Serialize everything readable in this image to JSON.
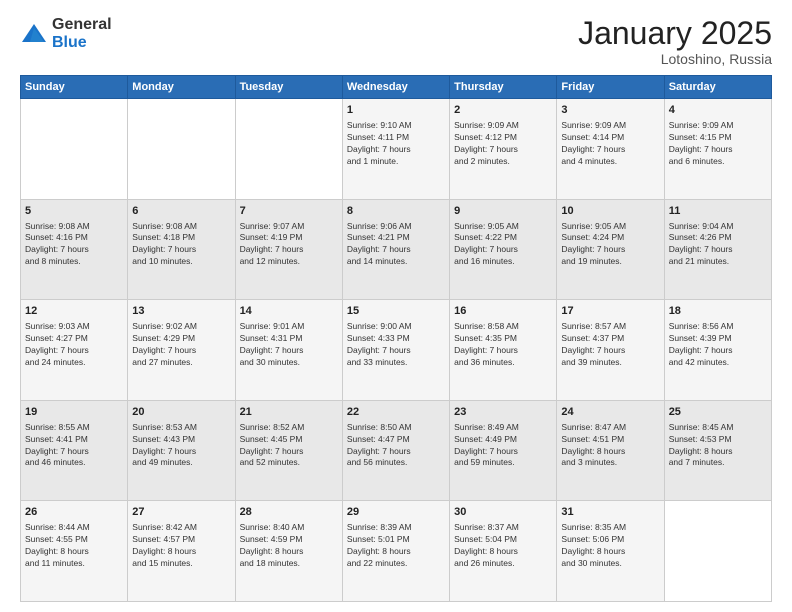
{
  "logo": {
    "general": "General",
    "blue": "Blue"
  },
  "header": {
    "month": "January 2025",
    "location": "Lotoshino, Russia"
  },
  "weekdays": [
    "Sunday",
    "Monday",
    "Tuesday",
    "Wednesday",
    "Thursday",
    "Friday",
    "Saturday"
  ],
  "weeks": [
    [
      {
        "day": "",
        "info": ""
      },
      {
        "day": "",
        "info": ""
      },
      {
        "day": "",
        "info": ""
      },
      {
        "day": "1",
        "info": "Sunrise: 9:10 AM\nSunset: 4:11 PM\nDaylight: 7 hours\nand 1 minute."
      },
      {
        "day": "2",
        "info": "Sunrise: 9:09 AM\nSunset: 4:12 PM\nDaylight: 7 hours\nand 2 minutes."
      },
      {
        "day": "3",
        "info": "Sunrise: 9:09 AM\nSunset: 4:14 PM\nDaylight: 7 hours\nand 4 minutes."
      },
      {
        "day": "4",
        "info": "Sunrise: 9:09 AM\nSunset: 4:15 PM\nDaylight: 7 hours\nand 6 minutes."
      }
    ],
    [
      {
        "day": "5",
        "info": "Sunrise: 9:08 AM\nSunset: 4:16 PM\nDaylight: 7 hours\nand 8 minutes."
      },
      {
        "day": "6",
        "info": "Sunrise: 9:08 AM\nSunset: 4:18 PM\nDaylight: 7 hours\nand 10 minutes."
      },
      {
        "day": "7",
        "info": "Sunrise: 9:07 AM\nSunset: 4:19 PM\nDaylight: 7 hours\nand 12 minutes."
      },
      {
        "day": "8",
        "info": "Sunrise: 9:06 AM\nSunset: 4:21 PM\nDaylight: 7 hours\nand 14 minutes."
      },
      {
        "day": "9",
        "info": "Sunrise: 9:05 AM\nSunset: 4:22 PM\nDaylight: 7 hours\nand 16 minutes."
      },
      {
        "day": "10",
        "info": "Sunrise: 9:05 AM\nSunset: 4:24 PM\nDaylight: 7 hours\nand 19 minutes."
      },
      {
        "day": "11",
        "info": "Sunrise: 9:04 AM\nSunset: 4:26 PM\nDaylight: 7 hours\nand 21 minutes."
      }
    ],
    [
      {
        "day": "12",
        "info": "Sunrise: 9:03 AM\nSunset: 4:27 PM\nDaylight: 7 hours\nand 24 minutes."
      },
      {
        "day": "13",
        "info": "Sunrise: 9:02 AM\nSunset: 4:29 PM\nDaylight: 7 hours\nand 27 minutes."
      },
      {
        "day": "14",
        "info": "Sunrise: 9:01 AM\nSunset: 4:31 PM\nDaylight: 7 hours\nand 30 minutes."
      },
      {
        "day": "15",
        "info": "Sunrise: 9:00 AM\nSunset: 4:33 PM\nDaylight: 7 hours\nand 33 minutes."
      },
      {
        "day": "16",
        "info": "Sunrise: 8:58 AM\nSunset: 4:35 PM\nDaylight: 7 hours\nand 36 minutes."
      },
      {
        "day": "17",
        "info": "Sunrise: 8:57 AM\nSunset: 4:37 PM\nDaylight: 7 hours\nand 39 minutes."
      },
      {
        "day": "18",
        "info": "Sunrise: 8:56 AM\nSunset: 4:39 PM\nDaylight: 7 hours\nand 42 minutes."
      }
    ],
    [
      {
        "day": "19",
        "info": "Sunrise: 8:55 AM\nSunset: 4:41 PM\nDaylight: 7 hours\nand 46 minutes."
      },
      {
        "day": "20",
        "info": "Sunrise: 8:53 AM\nSunset: 4:43 PM\nDaylight: 7 hours\nand 49 minutes."
      },
      {
        "day": "21",
        "info": "Sunrise: 8:52 AM\nSunset: 4:45 PM\nDaylight: 7 hours\nand 52 minutes."
      },
      {
        "day": "22",
        "info": "Sunrise: 8:50 AM\nSunset: 4:47 PM\nDaylight: 7 hours\nand 56 minutes."
      },
      {
        "day": "23",
        "info": "Sunrise: 8:49 AM\nSunset: 4:49 PM\nDaylight: 7 hours\nand 59 minutes."
      },
      {
        "day": "24",
        "info": "Sunrise: 8:47 AM\nSunset: 4:51 PM\nDaylight: 8 hours\nand 3 minutes."
      },
      {
        "day": "25",
        "info": "Sunrise: 8:45 AM\nSunset: 4:53 PM\nDaylight: 8 hours\nand 7 minutes."
      }
    ],
    [
      {
        "day": "26",
        "info": "Sunrise: 8:44 AM\nSunset: 4:55 PM\nDaylight: 8 hours\nand 11 minutes."
      },
      {
        "day": "27",
        "info": "Sunrise: 8:42 AM\nSunset: 4:57 PM\nDaylight: 8 hours\nand 15 minutes."
      },
      {
        "day": "28",
        "info": "Sunrise: 8:40 AM\nSunset: 4:59 PM\nDaylight: 8 hours\nand 18 minutes."
      },
      {
        "day": "29",
        "info": "Sunrise: 8:39 AM\nSunset: 5:01 PM\nDaylight: 8 hours\nand 22 minutes."
      },
      {
        "day": "30",
        "info": "Sunrise: 8:37 AM\nSunset: 5:04 PM\nDaylight: 8 hours\nand 26 minutes."
      },
      {
        "day": "31",
        "info": "Sunrise: 8:35 AM\nSunset: 5:06 PM\nDaylight: 8 hours\nand 30 minutes."
      },
      {
        "day": "",
        "info": ""
      }
    ]
  ]
}
